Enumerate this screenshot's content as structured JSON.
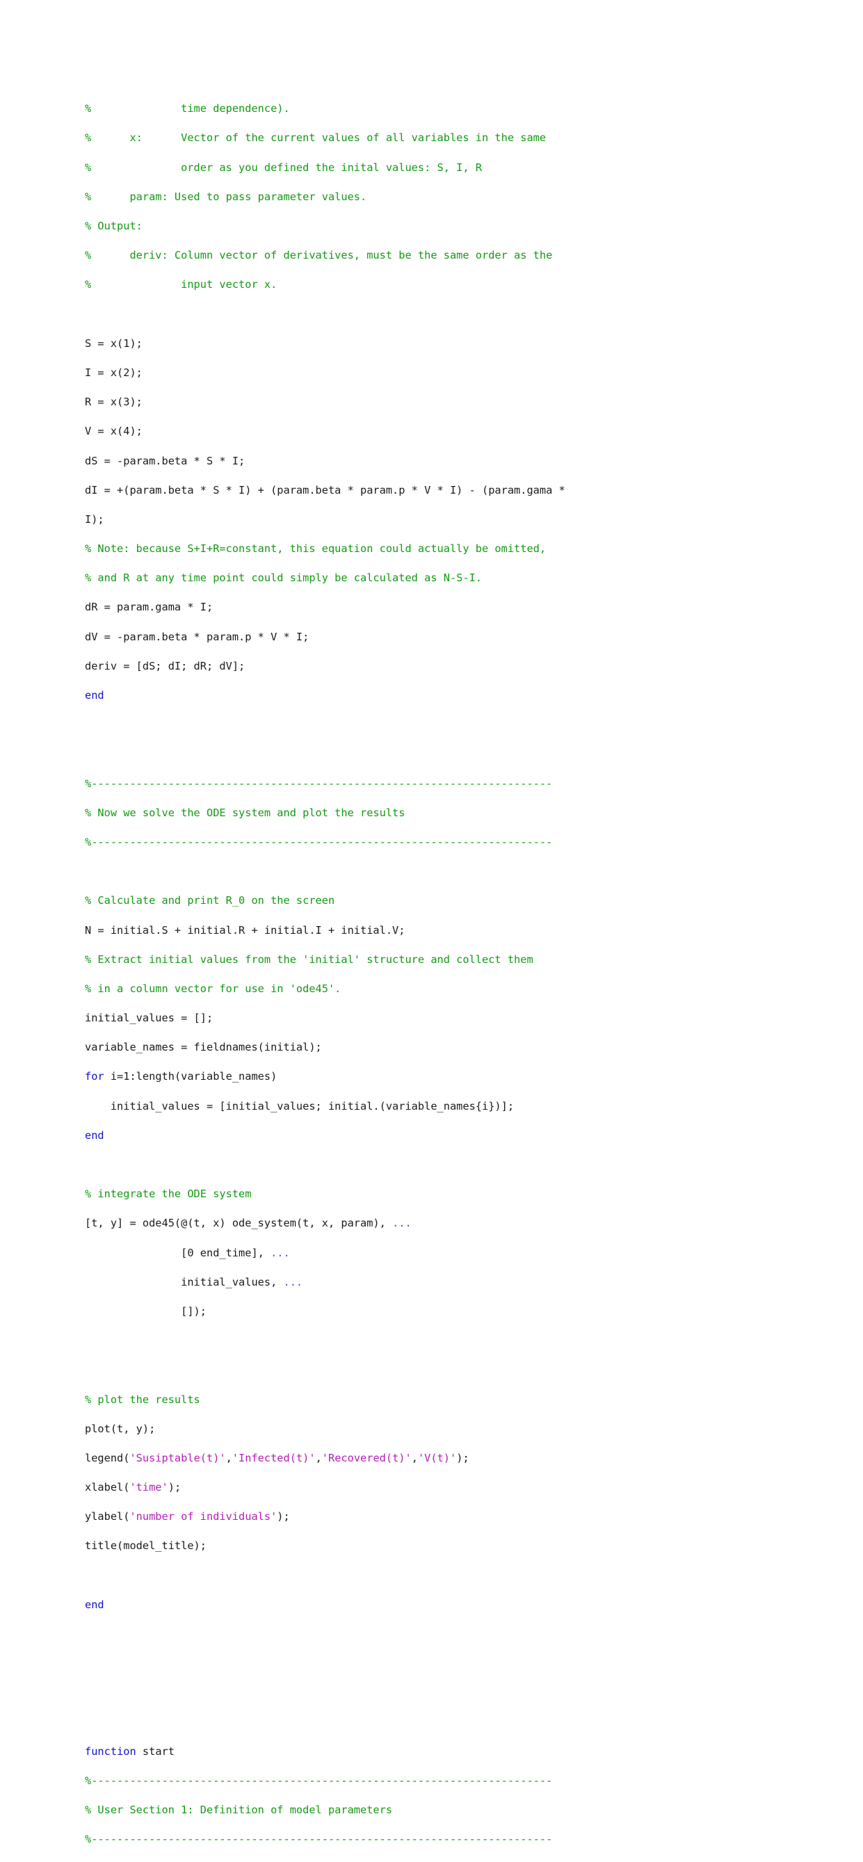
{
  "document": {
    "kind": "matlab-source-listing",
    "page_background": "#ffffff",
    "colors": {
      "comment": "#139A13",
      "keyword": "#1111CC",
      "string": "#B520B5",
      "plain": "#1a1a1a",
      "continuation": "#6A3FD6"
    }
  },
  "code": {
    "lines": [
      {
        "id": "l001",
        "segments": [
          {
            "style": "comment",
            "text": "%              time dependence)."
          }
        ]
      },
      {
        "id": "l002",
        "segments": [
          {
            "style": "comment",
            "text": "%      x:      Vector of the current values of all variables in the same"
          }
        ]
      },
      {
        "id": "l003",
        "segments": [
          {
            "style": "comment",
            "text": "%              order as you defined the inital values: S, I, R"
          }
        ]
      },
      {
        "id": "l004",
        "segments": [
          {
            "style": "comment",
            "text": "%      param: Used to pass parameter values."
          }
        ]
      },
      {
        "id": "l005",
        "segments": [
          {
            "style": "comment",
            "text": "% Output:"
          }
        ]
      },
      {
        "id": "l006",
        "segments": [
          {
            "style": "comment",
            "text": "%      deriv: Column vector of derivatives, must be the same order as the"
          }
        ]
      },
      {
        "id": "l007",
        "segments": [
          {
            "style": "comment",
            "text": "%              input vector x."
          }
        ]
      },
      {
        "id": "l008",
        "segments": []
      },
      {
        "id": "l009",
        "segments": [
          {
            "style": "plain",
            "text": "S = x(1);"
          }
        ]
      },
      {
        "id": "l010",
        "segments": [
          {
            "style": "plain",
            "text": "I = x(2);"
          }
        ]
      },
      {
        "id": "l011",
        "segments": [
          {
            "style": "plain",
            "text": "R = x(3);"
          }
        ]
      },
      {
        "id": "l012",
        "segments": [
          {
            "style": "plain",
            "text": "V = x(4);"
          }
        ]
      },
      {
        "id": "l013",
        "segments": [
          {
            "style": "plain",
            "text": "dS = -param.beta * S * I;"
          }
        ]
      },
      {
        "id": "l014",
        "segments": [
          {
            "style": "plain",
            "text": "dI = +(param.beta * S * I) + (param.beta * param.p * V * I) - (param.gama *"
          }
        ]
      },
      {
        "id": "l015",
        "segments": [
          {
            "style": "plain",
            "text": "I);"
          }
        ]
      },
      {
        "id": "l016",
        "segments": [
          {
            "style": "comment",
            "text": "% Note: because S+I+R=constant, this equation could actually be omitted,"
          }
        ]
      },
      {
        "id": "l017",
        "segments": [
          {
            "style": "comment",
            "text": "% and R at any time point could simply be calculated as N-S-I."
          }
        ]
      },
      {
        "id": "l018",
        "segments": [
          {
            "style": "plain",
            "text": "dR = param.gama * I;"
          }
        ]
      },
      {
        "id": "l019",
        "segments": [
          {
            "style": "plain",
            "text": "dV = -param.beta * param.p * V * I;"
          }
        ]
      },
      {
        "id": "l020",
        "segments": [
          {
            "style": "plain",
            "text": "deriv = [dS; dI; dR; dV];"
          }
        ]
      },
      {
        "id": "l021",
        "segments": [
          {
            "style": "keyword",
            "text": "end"
          }
        ]
      },
      {
        "id": "l022",
        "segments": []
      },
      {
        "id": "l023",
        "segments": []
      },
      {
        "id": "l024",
        "segments": [
          {
            "style": "comment",
            "text": "%------------------------------------------------------------------------"
          }
        ]
      },
      {
        "id": "l025",
        "segments": [
          {
            "style": "comment",
            "text": "% Now we solve the ODE system and plot the results"
          }
        ]
      },
      {
        "id": "l026",
        "segments": [
          {
            "style": "comment",
            "text": "%------------------------------------------------------------------------"
          }
        ]
      },
      {
        "id": "l027",
        "segments": []
      },
      {
        "id": "l028",
        "segments": [
          {
            "style": "comment",
            "text": "% Calculate and print R_0 on the screen"
          }
        ]
      },
      {
        "id": "l029",
        "segments": [
          {
            "style": "plain",
            "text": "N = initial.S + initial.R + initial.I + initial.V;"
          }
        ]
      },
      {
        "id": "l030",
        "segments": [
          {
            "style": "comment",
            "text": "% Extract initial values from the 'initial' structure and collect them"
          }
        ]
      },
      {
        "id": "l031",
        "segments": [
          {
            "style": "comment",
            "text": "% in a column vector for use in 'ode45'."
          }
        ]
      },
      {
        "id": "l032",
        "segments": [
          {
            "style": "plain",
            "text": "initial_values = [];"
          }
        ]
      },
      {
        "id": "l033",
        "segments": [
          {
            "style": "plain",
            "text": "variable_names = fieldnames(initial);"
          }
        ]
      },
      {
        "id": "l034",
        "segments": [
          {
            "style": "keyword",
            "text": "for"
          },
          {
            "style": "plain",
            "text": " i=1:length(variable_names)"
          }
        ]
      },
      {
        "id": "l035",
        "segments": [
          {
            "style": "plain",
            "text": "    initial_values = [initial_values; initial.(variable_names{i})];"
          }
        ]
      },
      {
        "id": "l036",
        "segments": [
          {
            "style": "keyword",
            "text": "end"
          }
        ]
      },
      {
        "id": "l037",
        "segments": []
      },
      {
        "id": "l038",
        "segments": [
          {
            "style": "comment",
            "text": "% integrate the ODE system"
          }
        ]
      },
      {
        "id": "l039",
        "segments": [
          {
            "style": "plain",
            "text": "[t, y] = ode45(@(t, x) ode_system(t, x, param), "
          },
          {
            "style": "continuation",
            "text": "..."
          }
        ]
      },
      {
        "id": "l040",
        "segments": [
          {
            "style": "plain",
            "text": "               [0 end_time], "
          },
          {
            "style": "continuation",
            "text": "..."
          }
        ]
      },
      {
        "id": "l041",
        "segments": [
          {
            "style": "plain",
            "text": "               initial_values, "
          },
          {
            "style": "continuation",
            "text": "..."
          }
        ]
      },
      {
        "id": "l042",
        "segments": [
          {
            "style": "plain",
            "text": "               []);"
          }
        ]
      },
      {
        "id": "l043",
        "segments": []
      },
      {
        "id": "l044",
        "segments": []
      },
      {
        "id": "l045",
        "segments": [
          {
            "style": "comment",
            "text": "% plot the results"
          }
        ]
      },
      {
        "id": "l046",
        "segments": [
          {
            "style": "plain",
            "text": "plot(t, y);"
          }
        ]
      },
      {
        "id": "l047",
        "segments": [
          {
            "style": "plain",
            "text": "legend("
          },
          {
            "style": "string",
            "text": "'Susiptable(t)'"
          },
          {
            "style": "plain",
            "text": ","
          },
          {
            "style": "string",
            "text": "'Infected(t)'"
          },
          {
            "style": "plain",
            "text": ","
          },
          {
            "style": "string",
            "text": "'Recovered(t)'"
          },
          {
            "style": "plain",
            "text": ","
          },
          {
            "style": "string",
            "text": "'V(t)'"
          },
          {
            "style": "plain",
            "text": ");"
          }
        ]
      },
      {
        "id": "l048",
        "segments": [
          {
            "style": "plain",
            "text": "xlabel("
          },
          {
            "style": "string",
            "text": "'time'"
          },
          {
            "style": "plain",
            "text": ");"
          }
        ]
      },
      {
        "id": "l049",
        "segments": [
          {
            "style": "plain",
            "text": "ylabel("
          },
          {
            "style": "string",
            "text": "'number of individuals'"
          },
          {
            "style": "plain",
            "text": ");"
          }
        ]
      },
      {
        "id": "l050",
        "segments": [
          {
            "style": "plain",
            "text": "title(model_title);"
          }
        ]
      },
      {
        "id": "l051",
        "segments": []
      },
      {
        "id": "l052",
        "segments": [
          {
            "style": "keyword",
            "text": "end"
          }
        ]
      },
      {
        "id": "l053",
        "segments": []
      },
      {
        "id": "l054",
        "segments": []
      },
      {
        "id": "l055",
        "segments": []
      },
      {
        "id": "l056",
        "segments": []
      },
      {
        "id": "l057",
        "segments": [
          {
            "style": "keyword",
            "text": "function"
          },
          {
            "style": "plain",
            "text": " start"
          }
        ]
      },
      {
        "id": "l058",
        "segments": [
          {
            "style": "comment",
            "text": "%------------------------------------------------------------------------"
          }
        ]
      },
      {
        "id": "l059",
        "segments": [
          {
            "style": "comment",
            "text": "% User Section 1: Definition of model parameters"
          }
        ]
      },
      {
        "id": "l060",
        "segments": [
          {
            "style": "comment",
            "text": "%------------------------------------------------------------------------"
          }
        ]
      }
    ]
  }
}
